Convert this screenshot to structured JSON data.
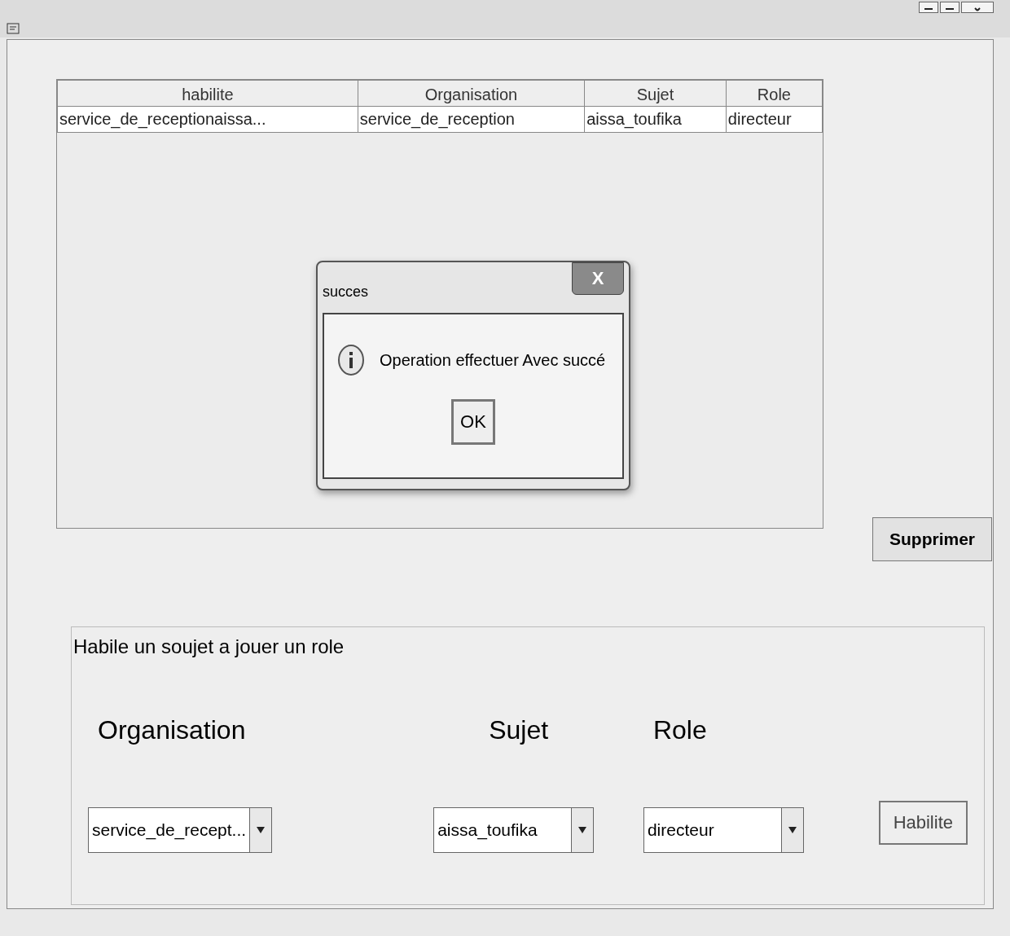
{
  "table": {
    "columns": [
      "habilite",
      "Organisation",
      "Sujet",
      "Role"
    ],
    "rows": [
      [
        "service_de_receptionaissa...",
        "service_de_reception",
        "aissa_toufika",
        "directeur"
      ]
    ]
  },
  "dialog": {
    "title": "succes",
    "close": "X",
    "message": "Operation effectuer Avec succé",
    "button": "OK"
  },
  "delete_button": "Supprimer",
  "form": {
    "legend": "Habile un soujet a jouer un role",
    "fields": [
      {
        "label": "Organisation",
        "value": "service_de_recept..."
      },
      {
        "label": "Sujet",
        "value": "aissa_toufika"
      },
      {
        "label": "Role",
        "value": "directeur"
      }
    ],
    "button": "Habilite"
  }
}
